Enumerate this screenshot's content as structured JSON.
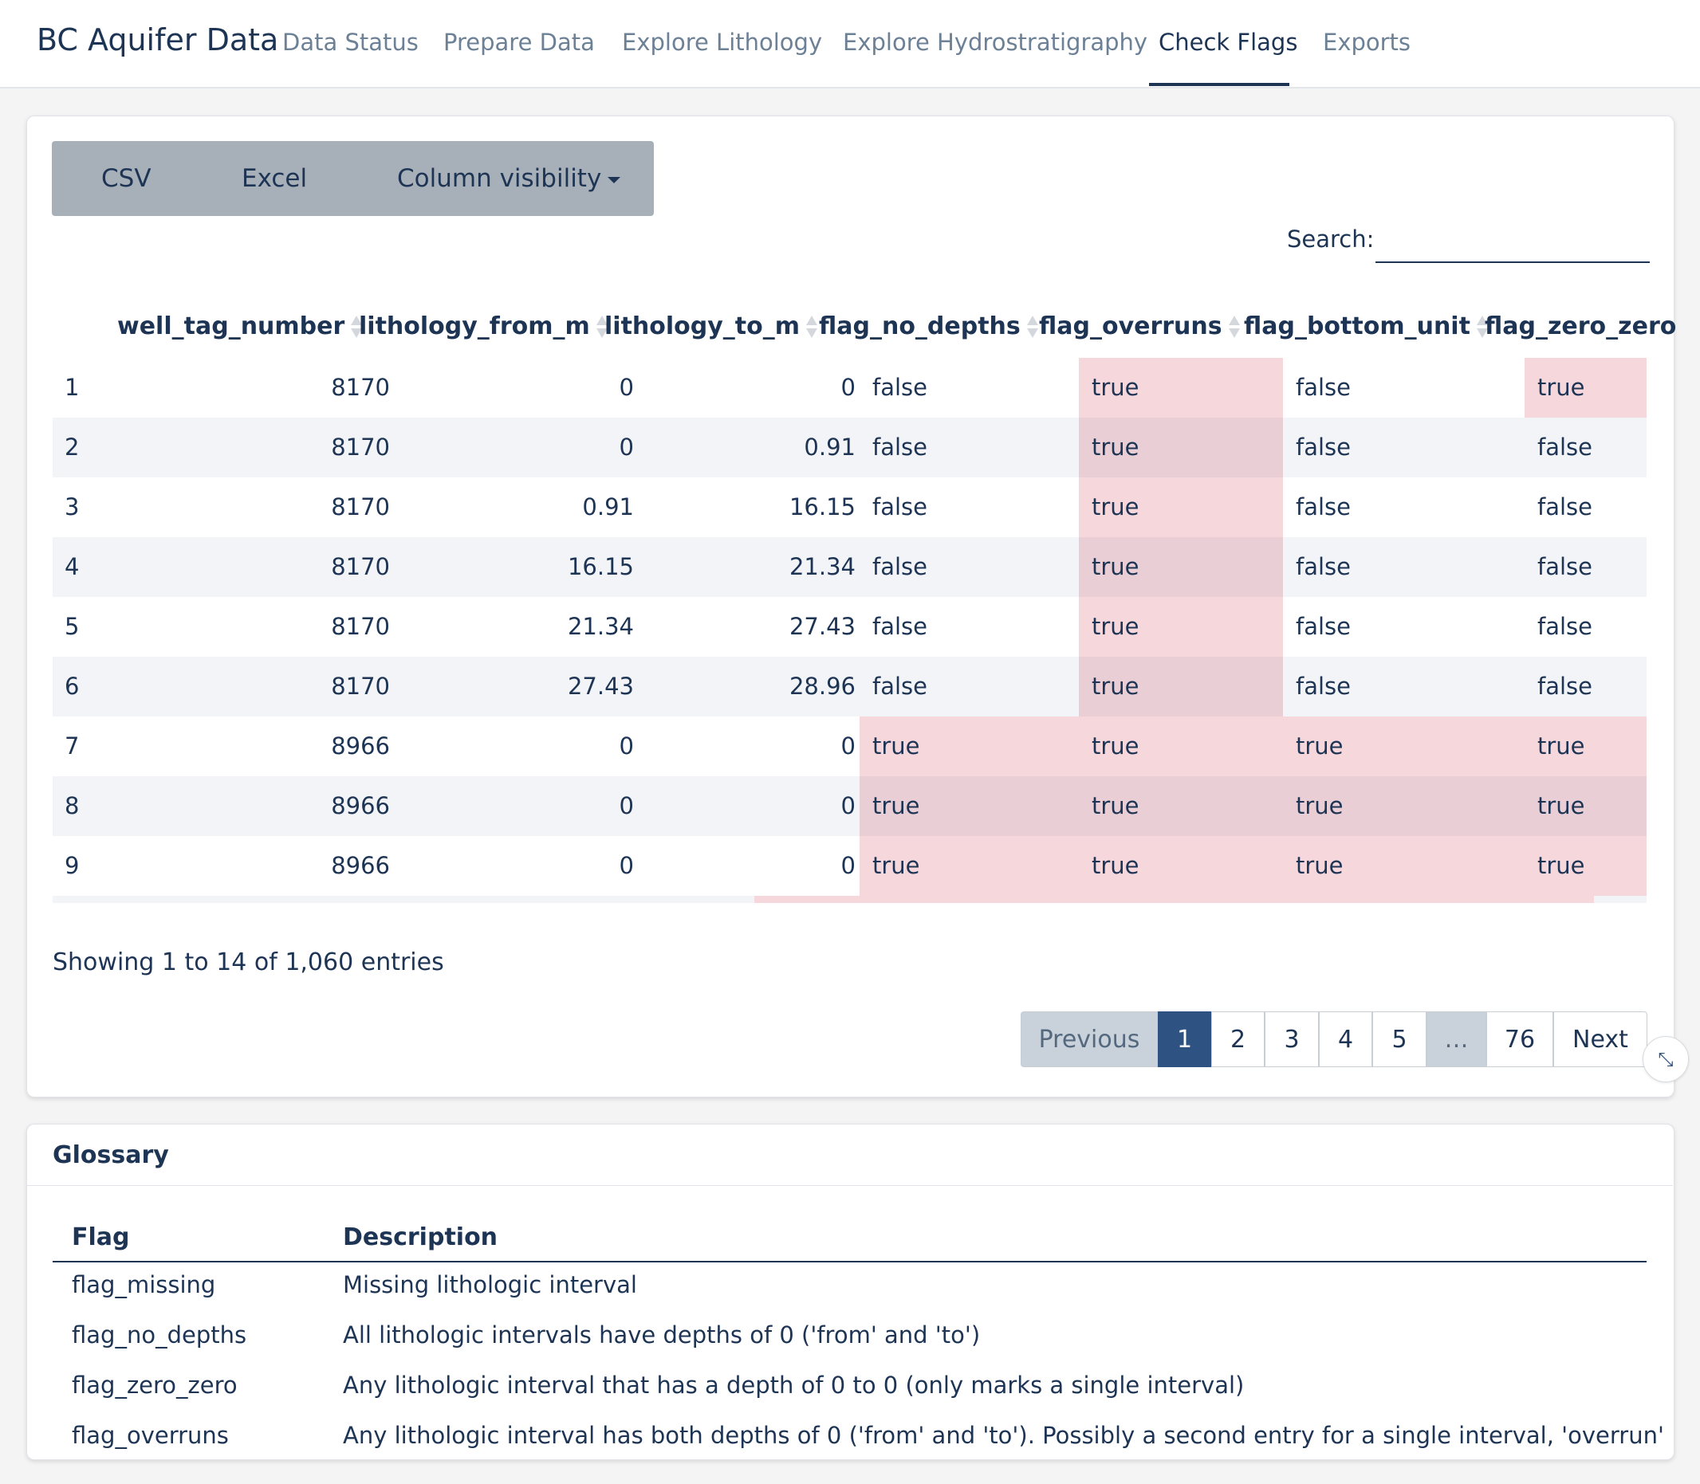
{
  "nav": {
    "brand": "BC Aquifer Data",
    "links": [
      "Data Status",
      "Prepare Data",
      "Explore Lithology",
      "Explore Hydrostratigraphy",
      "Check Flags",
      "Exports"
    ],
    "active": "Check Flags"
  },
  "toolbar": {
    "csv_label": "CSV",
    "excel_label": "Excel",
    "colvis_label": "Column visibility"
  },
  "search": {
    "label": "Search:",
    "value": ""
  },
  "table": {
    "columns": [
      "",
      "well_tag_number",
      "lithology_from_m",
      "lithology_to_m",
      "flag_no_depths",
      "flag_overruns",
      "flag_bottom_unit",
      "flag_zero_zero"
    ],
    "rows": [
      [
        "1",
        "8170",
        "0",
        "0",
        "false",
        "true",
        "false",
        "true"
      ],
      [
        "2",
        "8170",
        "0",
        "0.91",
        "false",
        "true",
        "false",
        "false"
      ],
      [
        "3",
        "8170",
        "0.91",
        "16.15",
        "false",
        "true",
        "false",
        "false"
      ],
      [
        "4",
        "8170",
        "16.15",
        "21.34",
        "false",
        "true",
        "false",
        "false"
      ],
      [
        "5",
        "8170",
        "21.34",
        "27.43",
        "false",
        "true",
        "false",
        "false"
      ],
      [
        "6",
        "8170",
        "27.43",
        "28.96",
        "false",
        "true",
        "false",
        "false"
      ],
      [
        "7",
        "8966",
        "0",
        "0",
        "true",
        "true",
        "true",
        "true"
      ],
      [
        "8",
        "8966",
        "0",
        "0",
        "true",
        "true",
        "true",
        "true"
      ],
      [
        "9",
        "8966",
        "0",
        "0",
        "true",
        "true",
        "true",
        "true"
      ]
    ],
    "highlight_color": "#f6d7dc"
  },
  "info": "Showing 1 to 14 of 1,060 entries",
  "pagination": {
    "previous": "Previous",
    "pages": [
      "1",
      "2",
      "3",
      "4",
      "5",
      "…",
      "76"
    ],
    "next": "Next",
    "current": "1"
  },
  "glossary": {
    "title": "Glossary",
    "headers": [
      "Flag",
      "Description"
    ],
    "rows": [
      [
        "flag_missing",
        "Missing lithologic interval"
      ],
      [
        "flag_no_depths",
        "All lithologic intervals have depths of 0 ('from' and 'to')"
      ],
      [
        "flag_zero_zero",
        "Any lithologic interval that has a depth of 0 to 0 (only marks a single interval)"
      ],
      [
        "flag_overruns",
        "Any lithologic interval has both depths of 0 ('from' and 'to'). Possibly a second entry for a single interval, 'overrun'"
      ]
    ]
  },
  "colors": {
    "primary": "#1d3454",
    "active_page": "#2e5282",
    "button_bg": "#a7afb8"
  }
}
